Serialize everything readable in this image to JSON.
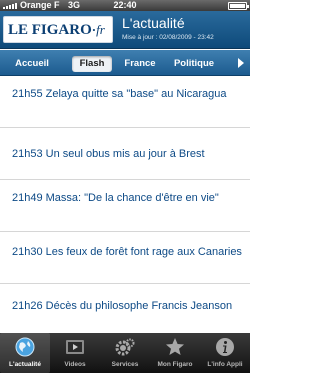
{
  "status_bar": {
    "carrier": "Orange F",
    "network": "3G",
    "time": "22:40"
  },
  "header": {
    "logo_main": "LE FIGARO",
    "logo_dot": "·",
    "logo_fr": "fr",
    "title": "L'actualité",
    "subtitle": "Mise à jour : 02/08/2009 - 23:42"
  },
  "section_nav": {
    "tabs": [
      {
        "label": "Accueil",
        "active": false
      },
      {
        "label": "Flash",
        "active": true
      },
      {
        "label": "France",
        "active": false
      },
      {
        "label": "Politique",
        "active": false
      }
    ]
  },
  "news": [
    {
      "text": "21h55 Zelaya quitte sa \"base\" au Nicaragua"
    },
    {
      "text": "21h53 Un seul obus mis au jour à Brest"
    },
    {
      "text": "21h49 Massa: \"De la chance d'être en vie\""
    },
    {
      "text": "21h30 Les feux de forêt font rage aux Canaries"
    },
    {
      "text": "21h26 Décès du philosophe Francis Jeanson"
    }
  ],
  "bottom_bar": {
    "tabs": [
      {
        "label": "L'actualité",
        "icon": "globe-icon",
        "active": true
      },
      {
        "label": "Videos",
        "icon": "video-icon",
        "active": false
      },
      {
        "label": "Services",
        "icon": "gear-icon",
        "active": false
      },
      {
        "label": "Mon Figaro",
        "icon": "star-icon",
        "active": false
      },
      {
        "label": "L'info Appli",
        "icon": "info-icon",
        "active": false
      }
    ]
  },
  "colors": {
    "header": "#1b5a8c",
    "news_text": "#0d4a86"
  }
}
